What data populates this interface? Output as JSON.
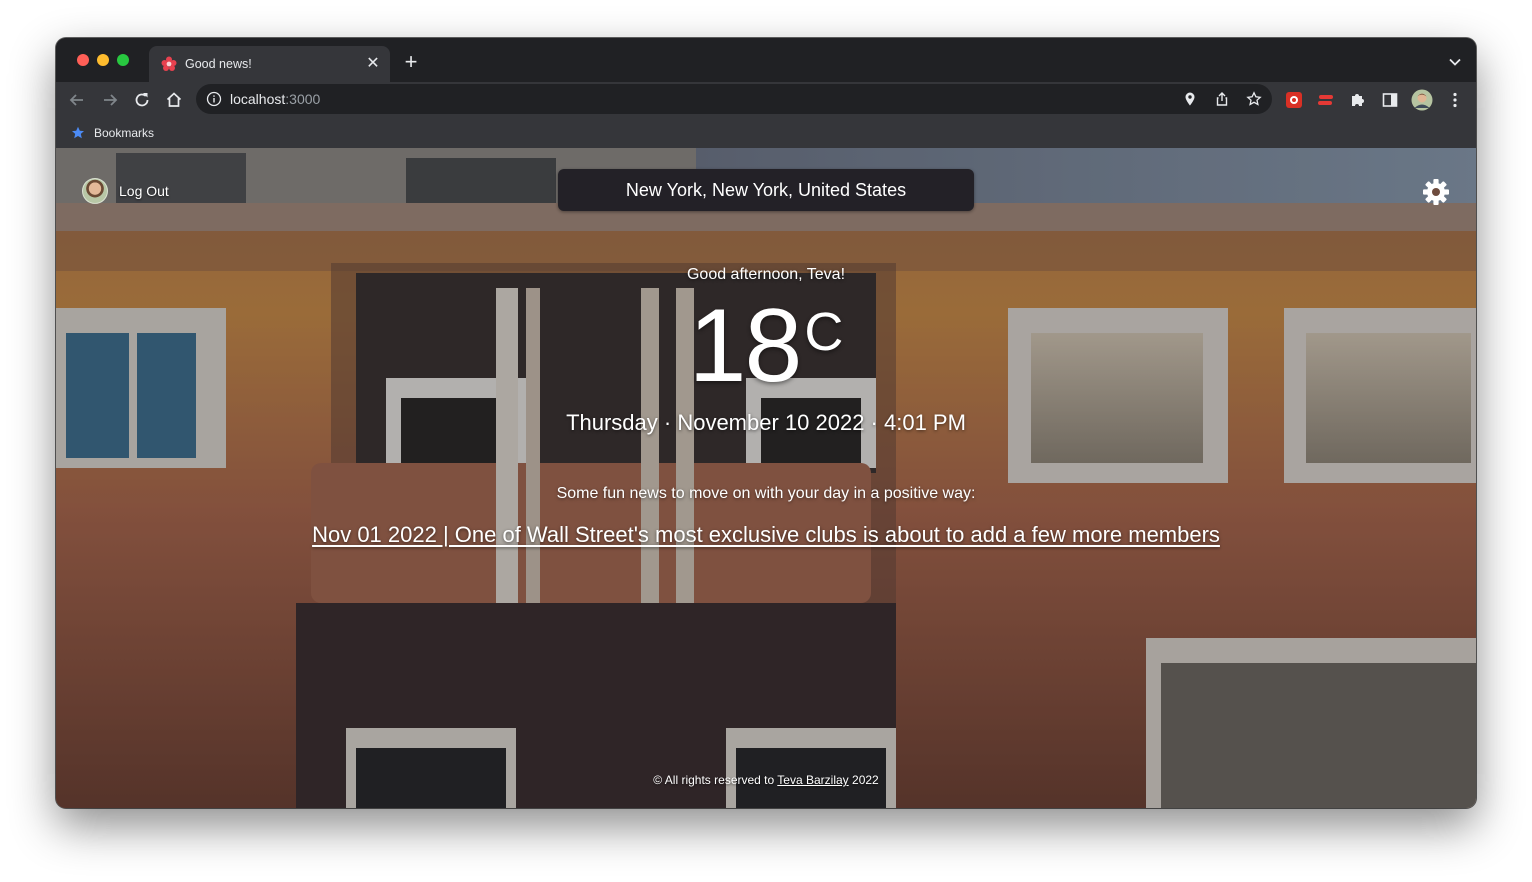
{
  "browser": {
    "tab": {
      "title": "Good news!"
    },
    "address": {
      "host": "localhost",
      "port": ":3000"
    },
    "bookmarks": {
      "label": "Bookmarks"
    }
  },
  "app": {
    "logout_label": "Log Out",
    "location": "New York, New York, United States",
    "greeting": "Good afternoon, Teva!",
    "temperature": "18",
    "unit": "C",
    "datetime": "Thursday · November 10 2022 · 4:01 PM",
    "news_intro": "Some fun news to move on with your day in a positive way:",
    "headline": "Nov 01 2022 | One of Wall Street's most exclusive clubs is about to add a few more members",
    "footer": {
      "prefix": "© All rights reserved to",
      "author": "Teva Barzilay",
      "year": "2022"
    }
  },
  "colors": {
    "chrome_dark": "#202124",
    "chrome_toolbar": "#35363a",
    "location_box": "#232127",
    "text": "#ffffff"
  },
  "icons": [
    "app-favicon-icon",
    "back-arrow-icon",
    "forward-arrow-icon",
    "reload-icon",
    "home-icon",
    "info-icon",
    "location-pin-icon",
    "share-icon",
    "bookmark-star-icon",
    "extension-icon",
    "puzzle-icon",
    "side-panel-icon",
    "profile-avatar-icon",
    "kebab-menu-icon",
    "gear-icon"
  ]
}
